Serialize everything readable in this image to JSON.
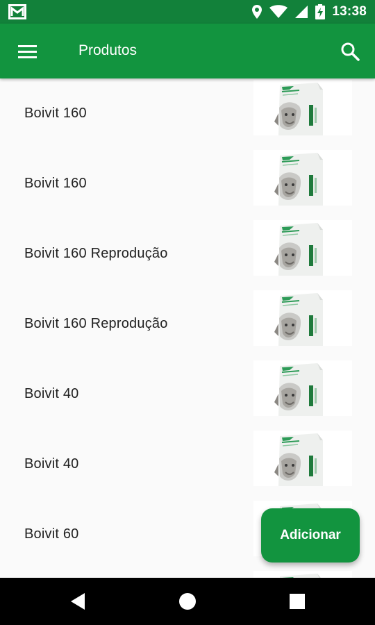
{
  "status_bar": {
    "time": "13:38",
    "icons": [
      "mail-icon",
      "location-icon",
      "wifi-icon",
      "signal-icon",
      "battery-charging-icon"
    ]
  },
  "app_bar": {
    "title": "Produtos",
    "menu_icon": "menu-icon",
    "search_icon": "search-icon"
  },
  "products": [
    {
      "name": "Boivit 160"
    },
    {
      "name": "Boivit 160"
    },
    {
      "name": "Boivit 160 Reprodução"
    },
    {
      "name": "Boivit 160 Reprodução"
    },
    {
      "name": "Boivit 40"
    },
    {
      "name": "Boivit 40"
    },
    {
      "name": "Boivit 60"
    }
  ],
  "fab": {
    "label": "Adicionar"
  },
  "nav_bar": {
    "icons": [
      "back-icon",
      "home-icon",
      "recents-icon"
    ]
  },
  "colors": {
    "primary": "#12943f",
    "status_bar": "#12813a"
  }
}
